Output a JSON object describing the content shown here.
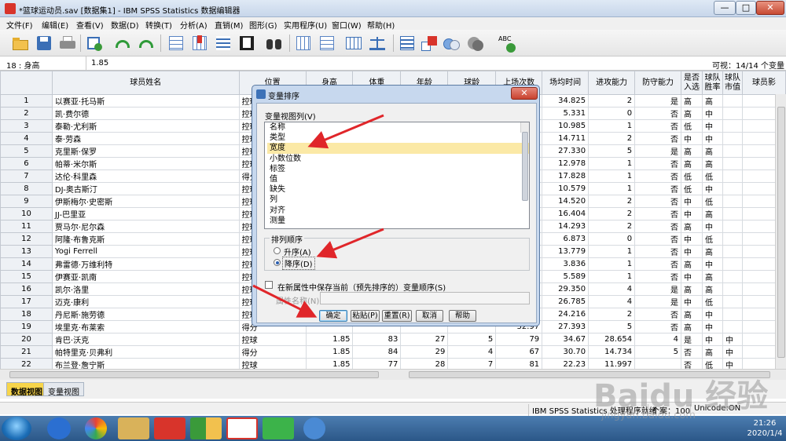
{
  "window": {
    "title": "*篮球运动员.sav [数据集1] - IBM SPSS Statistics 数据编辑器",
    "min": "—",
    "max": "□",
    "close": "✕"
  },
  "menu": [
    "文件(F)",
    "编辑(E)",
    "查看(V)",
    "数据(D)",
    "转换(T)",
    "分析(A)",
    "直销(M)",
    "图形(G)",
    "实用程序(U)",
    "窗口(W)",
    "帮助(H)"
  ],
  "toolbar": {
    "icons": [
      "open-icon",
      "save-icon",
      "print-icon",
      "dialog-recall-icon",
      "undo-icon",
      "redo-icon",
      "goto-case-icon",
      "goto-variable-icon",
      "variables-icon",
      "insert-cases-icon",
      "insert-variable-icon",
      "split-file-icon",
      "find-icon",
      "value-labels-icon",
      "weight-cases-icon",
      "select-cases-icon",
      "use-sets-icon",
      "show-all-icon",
      "sets-icon",
      "spellcheck-icon"
    ],
    "spell_label": "ABC"
  },
  "cellbar": {
    "ref": "18 : 身高",
    "value": "1.85",
    "visible": "可视：14/14 个变量"
  },
  "grid": {
    "columns": [
      "球员姓名",
      "位置",
      "身高",
      "体重",
      "年龄",
      "球龄",
      "上场次数",
      "场均时间",
      "进攻能力",
      "防守能力",
      "是否\n入选",
      "球队\n胜率",
      "球队\n市值",
      "球员影"
    ],
    "rows": [
      [
        "1",
        "以赛亚·托马斯",
        "控球",
        "",
        "",
        "",
        "",
        "33.78",
        "34.825",
        "2",
        "是",
        "高",
        "高"
      ],
      [
        "2",
        "凯·费尔德",
        "控球",
        "",
        "",
        "",
        "",
        "9.18",
        "5.331",
        "0",
        "否",
        "高",
        "中"
      ],
      [
        "3",
        "泰勒·尤利斯",
        "控球",
        "",
        "",
        "",
        "",
        "18.40",
        "10.985",
        "1",
        "否",
        "低",
        "中"
      ],
      [
        "4",
        "泰·劳森",
        "控球",
        "",
        "",
        "",
        "",
        "25.10",
        "14.711",
        "2",
        "否",
        "中",
        "中"
      ],
      [
        "5",
        "克里斯·保罗",
        "控球",
        "",
        "",
        "",
        "",
        "31.48",
        "27.330",
        "5",
        "是",
        "高",
        "高"
      ],
      [
        "6",
        "帕蒂·米尔斯",
        "控球",
        "",
        "",
        "",
        "",
        "21.92",
        "12.978",
        "1",
        "否",
        "高",
        "高"
      ],
      [
        "7",
        "达伦·科里森",
        "得分",
        "",
        "",
        "",
        "",
        "30.33",
        "17.828",
        "1",
        "否",
        "低",
        "低"
      ],
      [
        "8",
        "DJ-奥古斯汀",
        "控球",
        "",
        "",
        "",
        "",
        "19.72",
        "10.579",
        "1",
        "否",
        "低",
        "中"
      ],
      [
        "9",
        "伊斯梅尔·史密斯",
        "控球",
        "",
        "",
        "",
        "",
        "24.13",
        "14.520",
        "2",
        "否",
        "中",
        "低"
      ],
      [
        "10",
        "JJ-巴里亚",
        "控球",
        "",
        "",
        "",
        "",
        "22.02",
        "16.404",
        "2",
        "否",
        "中",
        "高"
      ],
      [
        "11",
        "贾马尔·尼尔森",
        "控球",
        "",
        "",
        "",
        "",
        "27.25",
        "14.293",
        "2",
        "否",
        "高",
        "中"
      ],
      [
        "12",
        "阿隆·布鲁克斯",
        "控球",
        "",
        "",
        "",
        "",
        "13.73",
        "6.873",
        "0",
        "否",
        "中",
        "低"
      ],
      [
        "13",
        "Yogi Ferrell",
        "控球",
        "",
        "",
        "",
        "",
        "26.02",
        "13.779",
        "1",
        "否",
        "中",
        "高"
      ],
      [
        "14",
        "弗雷德·万维利特",
        "控球",
        "",
        "",
        "",
        "",
        "7.93",
        "3.836",
        "1",
        "否",
        "高",
        "中"
      ],
      [
        "15",
        "伊赛亚·凯南",
        "控球",
        "",
        "",
        "",
        "",
        "15.17",
        "5.589",
        "1",
        "否",
        "中",
        "高"
      ],
      [
        "16",
        "凯尔·洛里",
        "控球",
        "",
        "",
        "",
        "",
        "37.40",
        "29.350",
        "4",
        "是",
        "高",
        "高"
      ],
      [
        "17",
        "迈克·康利",
        "控球",
        "",
        "",
        "",
        "",
        "33.20",
        "26.785",
        "4",
        "是",
        "中",
        "低"
      ],
      [
        "18",
        "丹尼斯·施劳德",
        "控球",
        "",
        "",
        "",
        "",
        "31.45",
        "24.216",
        "2",
        "否",
        "高",
        "中"
      ],
      [
        "19",
        "埃里克·布莱索",
        "得分",
        "",
        "",
        "",
        "",
        "32.97",
        "27.393",
        "5",
        "否",
        "高",
        "中"
      ],
      [
        "20",
        "肯巴·沃克",
        "控球",
        "1.85",
        "83",
        "27",
        "5",
        "79",
        "34.67",
        "28.654",
        "4",
        "是",
        "中",
        "中"
      ],
      [
        "21",
        "帕特里克·贝弗利",
        "得分",
        "1.85",
        "84",
        "29",
        "4",
        "67",
        "30.70",
        "14.734",
        "5",
        "否",
        "高",
        "中"
      ],
      [
        "22",
        "布兰登·詹宁斯",
        "控球",
        "1.85",
        "77",
        "28",
        "7",
        "81",
        "22.23",
        "11.997",
        "",
        "否",
        "低",
        "中"
      ]
    ]
  },
  "tabs": {
    "data_view": "数据视图",
    "variable_view": "变量视图"
  },
  "status": {
    "processor": "IBM SPSS Statistics 处理程序就绪",
    "cases": "个案：100",
    "unicode": "Unicode:ON"
  },
  "dialog": {
    "title": "变量排序",
    "list_label": "变量视图列(V)",
    "items": [
      "名称",
      "类型",
      "宽度",
      "小数位数",
      "标签",
      "值",
      "缺失",
      "列",
      "对齐",
      "测量"
    ],
    "selected_index": 2,
    "sort_legend": "排列顺序",
    "ascending": "升序(A)",
    "descending": "降序(D)",
    "selected_order": "descending",
    "save_checkbox": "在新属性中保存当前（预先排序的）变量顺序(S)",
    "property_name_label": "属性名称(N):",
    "property_name_value": "",
    "buttons": {
      "ok": "确定",
      "paste": "粘贴(P)",
      "reset": "重置(R)",
      "cancel": "取消",
      "help": "帮助"
    }
  },
  "taskbar": {
    "time": "21:26",
    "date": "2020/1/4"
  },
  "watermark": {
    "brand": "Baidu 经验",
    "url": "jingyan.baidu.com"
  },
  "colors": {
    "accent": "#2b5fb0",
    "selection": "#fbe9a6",
    "arrow": "#e0262a",
    "active_tab": "#f7d54a"
  }
}
